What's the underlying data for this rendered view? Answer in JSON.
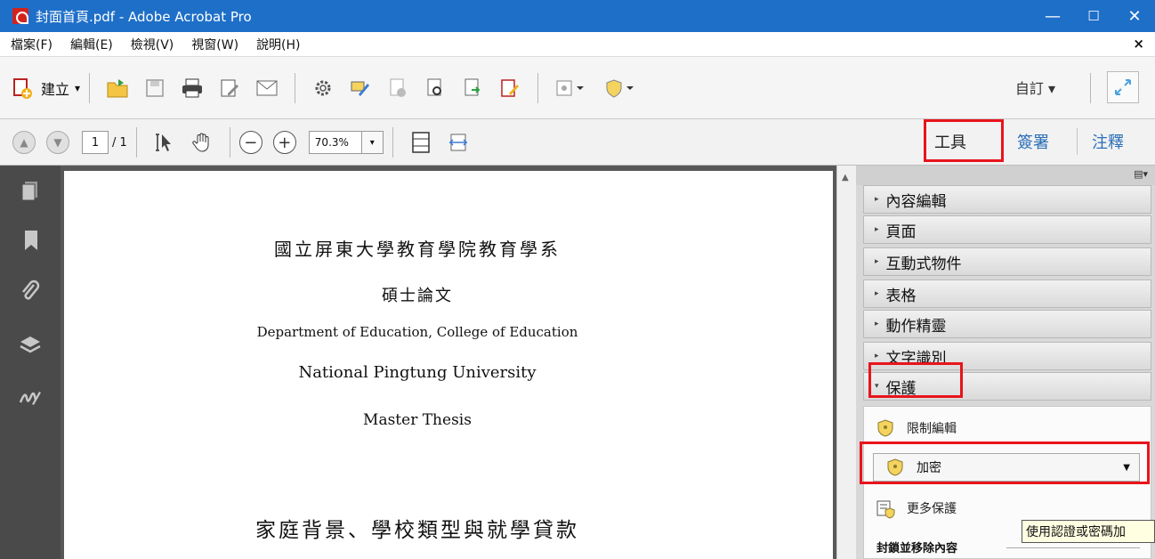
{
  "window": {
    "title": "封面首頁.pdf - Adobe Acrobat Pro",
    "minimize": "—",
    "maximize": "☐",
    "close": "✕"
  },
  "menu": {
    "items": [
      "檔案(F)",
      "編輯(E)",
      "檢視(V)",
      "視窗(W)",
      "說明(H)"
    ],
    "close": "×"
  },
  "toolbar": {
    "create_label": "建立",
    "create_caret": "▾",
    "customize_label": "自訂 ▾"
  },
  "nav": {
    "current_page": "1",
    "total_pages": "/ 1",
    "zoom": "70.3%",
    "zoom_caret": "▾"
  },
  "pane_tabs": {
    "tools": "工具",
    "sign": "簽署",
    "comment": "注釋"
  },
  "document": {
    "lines": [
      "國立屏東大學教育學院教育學系",
      "碩士論文",
      "Department of Education, College of Education",
      "National Pingtung University",
      "Master Thesis",
      "家庭背景、學校類型與就學貸款"
    ]
  },
  "tools_pane": {
    "options": "▤▾",
    "sections": [
      {
        "label": "內容編輯",
        "arrow": "▸"
      },
      {
        "label": "頁面",
        "arrow": "▸"
      },
      {
        "label": "互動式物件",
        "arrow": "▸"
      },
      {
        "label": "表格",
        "arrow": "▸"
      },
      {
        "label": "動作精靈",
        "arrow": "▸"
      },
      {
        "label": "文字識別",
        "arrow": "▸"
      },
      {
        "label": "保護",
        "arrow": "▾"
      }
    ],
    "protect": {
      "restrict_edit": "限制編輯",
      "encrypt": "加密",
      "encrypt_caret": "▼",
      "more_protection": "更多保護",
      "tooltip": "使用認證或密碼加",
      "subsection": "封鎖並移除內容"
    }
  },
  "colors": {
    "titlebar": "#1e6fc8",
    "highlight": "#e8141c",
    "link_blue": "#2a6fb8"
  }
}
